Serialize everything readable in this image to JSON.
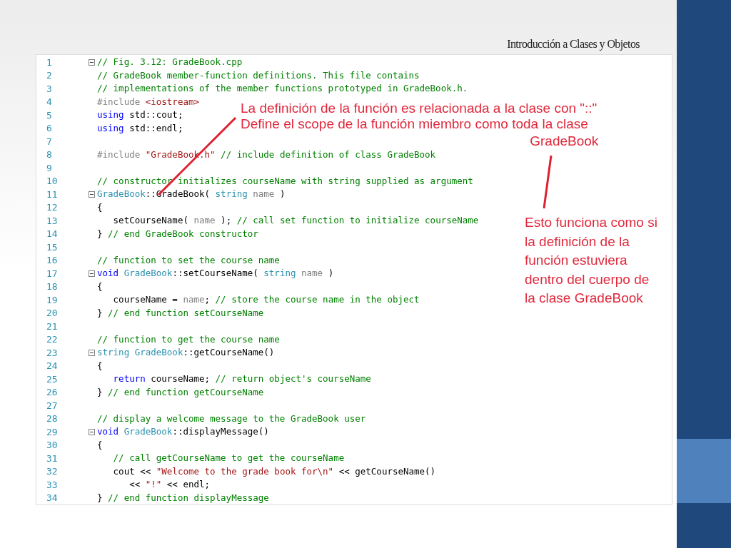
{
  "slide": {
    "title": "Introducción a Clases y Objetos"
  },
  "code": {
    "lines": [
      {
        "number": "1",
        "fold": true,
        "tokens": [
          {
            "kind": "comment",
            "text": "// Fig. 3.12: GradeBook.cpp"
          }
        ]
      },
      {
        "number": "2",
        "fold": false,
        "tokens": [
          {
            "kind": "comment",
            "text": "// GradeBook member-function definitions. This file contains"
          }
        ]
      },
      {
        "number": "3",
        "fold": false,
        "tokens": [
          {
            "kind": "comment",
            "text": "// implementations of the member functions prototyped in GradeBook.h."
          }
        ]
      },
      {
        "number": "4",
        "fold": false,
        "tokens": [
          {
            "kind": "preproc",
            "text": "#include "
          },
          {
            "kind": "string",
            "text": "<iostream>"
          }
        ]
      },
      {
        "number": "5",
        "fold": false,
        "tokens": [
          {
            "kind": "keyword",
            "text": "using"
          },
          {
            "kind": "plain",
            "text": " std::cout;"
          }
        ]
      },
      {
        "number": "6",
        "fold": false,
        "tokens": [
          {
            "kind": "keyword",
            "text": "using"
          },
          {
            "kind": "plain",
            "text": " std::endl;"
          }
        ]
      },
      {
        "number": "7",
        "fold": false
      },
      {
        "number": "8",
        "fold": false,
        "tokens": [
          {
            "kind": "preproc",
            "text": "#include "
          },
          {
            "kind": "string",
            "text": "\"GradeBook.h\""
          },
          {
            "kind": "comment",
            "text": " // include definition of class GradeBook"
          }
        ]
      },
      {
        "number": "9",
        "fold": false
      },
      {
        "number": "10",
        "fold": false,
        "tokens": [
          {
            "kind": "comment",
            "text": "// constructor initializes courseName with string supplied as argument"
          }
        ]
      },
      {
        "number": "11",
        "fold": true,
        "tokens": [
          {
            "kind": "type",
            "text": "GradeBook"
          },
          {
            "kind": "plain",
            "text": "::GradeBook( "
          },
          {
            "kind": "type",
            "text": "string"
          },
          {
            "kind": "param",
            "text": " name"
          },
          {
            "kind": "plain",
            "text": " )"
          }
        ]
      },
      {
        "number": "12",
        "fold": false,
        "tokens": [
          {
            "kind": "plain",
            "text": "{"
          }
        ]
      },
      {
        "number": "13",
        "fold": false,
        "tokens": [
          {
            "kind": "plain",
            "text": "   setCourseName( "
          },
          {
            "kind": "param",
            "text": "name"
          },
          {
            "kind": "plain",
            "text": " );"
          },
          {
            "kind": "comment",
            "text": " // call set function to initialize courseName"
          }
        ]
      },
      {
        "number": "14",
        "fold": false,
        "tokens": [
          {
            "kind": "plain",
            "text": "}"
          },
          {
            "kind": "comment",
            "text": " // end GradeBook constructor"
          }
        ]
      },
      {
        "number": "15",
        "fold": false
      },
      {
        "number": "16",
        "fold": false,
        "tokens": [
          {
            "kind": "comment",
            "text": "// function to set the course name"
          }
        ]
      },
      {
        "number": "17",
        "fold": true,
        "tokens": [
          {
            "kind": "keyword",
            "text": "void"
          },
          {
            "kind": "type",
            "text": " GradeBook"
          },
          {
            "kind": "plain",
            "text": "::setCourseName( "
          },
          {
            "kind": "type",
            "text": "string"
          },
          {
            "kind": "param",
            "text": " name"
          },
          {
            "kind": "plain",
            "text": " )"
          }
        ]
      },
      {
        "number": "18",
        "fold": false,
        "tokens": [
          {
            "kind": "plain",
            "text": "{"
          }
        ]
      },
      {
        "number": "19",
        "fold": false,
        "tokens": [
          {
            "kind": "plain",
            "text": "   courseName = "
          },
          {
            "kind": "param",
            "text": "name"
          },
          {
            "kind": "plain",
            "text": ";"
          },
          {
            "kind": "comment",
            "text": " // store the course name in the object"
          }
        ]
      },
      {
        "number": "20",
        "fold": false,
        "tokens": [
          {
            "kind": "plain",
            "text": "}"
          },
          {
            "kind": "comment",
            "text": " // end function setCourseName"
          }
        ]
      },
      {
        "number": "21",
        "fold": false
      },
      {
        "number": "22",
        "fold": false,
        "tokens": [
          {
            "kind": "comment",
            "text": "// function to get the course name"
          }
        ]
      },
      {
        "number": "23",
        "fold": true,
        "tokens": [
          {
            "kind": "type",
            "text": "string GradeBook"
          },
          {
            "kind": "plain",
            "text": "::getCourseName()"
          }
        ]
      },
      {
        "number": "24",
        "fold": false,
        "tokens": [
          {
            "kind": "plain",
            "text": "{"
          }
        ]
      },
      {
        "number": "25",
        "fold": false,
        "tokens": [
          {
            "kind": "keyword",
            "text": "   return"
          },
          {
            "kind": "plain",
            "text": " courseName;"
          },
          {
            "kind": "comment",
            "text": " // return object's courseName"
          }
        ]
      },
      {
        "number": "26",
        "fold": false,
        "tokens": [
          {
            "kind": "plain",
            "text": "}"
          },
          {
            "kind": "comment",
            "text": " // end function getCourseName"
          }
        ]
      },
      {
        "number": "27",
        "fold": false
      },
      {
        "number": "28",
        "fold": false,
        "tokens": [
          {
            "kind": "comment",
            "text": "// display a welcome message to the GradeBook user"
          }
        ]
      },
      {
        "number": "29",
        "fold": true,
        "tokens": [
          {
            "kind": "keyword",
            "text": "void"
          },
          {
            "kind": "type",
            "text": " GradeBook"
          },
          {
            "kind": "plain",
            "text": "::displayMessage()"
          }
        ]
      },
      {
        "number": "30",
        "fold": false,
        "tokens": [
          {
            "kind": "plain",
            "text": "{"
          }
        ]
      },
      {
        "number": "31",
        "fold": false,
        "tokens": [
          {
            "kind": "comment",
            "text": "   // call getCourseName to get the courseName"
          }
        ]
      },
      {
        "number": "32",
        "fold": false,
        "tokens": [
          {
            "kind": "plain",
            "text": "   cout << "
          },
          {
            "kind": "string",
            "text": "\"Welcome to the grade book for\\n\""
          },
          {
            "kind": "plain",
            "text": " << getCourseName()"
          }
        ]
      },
      {
        "number": "33",
        "fold": false,
        "tokens": [
          {
            "kind": "plain",
            "text": "      << "
          },
          {
            "kind": "string",
            "text": "\"!\""
          },
          {
            "kind": "plain",
            "text": " << endl;"
          }
        ]
      },
      {
        "number": "34",
        "fold": false,
        "tokens": [
          {
            "kind": "plain",
            "text": "}"
          },
          {
            "kind": "comment",
            "text": " // end function displayMessage"
          }
        ]
      }
    ]
  },
  "annotations": [
    {
      "lines": [
        "La definición de la función es relacionada a la clase con \"::\"",
        "Define el scope de la función miembro como toda la clase"
      ],
      "tail": "GradeBook"
    },
    {
      "lines": [
        "Esto funciona como si",
        "la definición de la",
        "función estuviera",
        "dentro del cuerpo de",
        "la clase GradeBook"
      ]
    }
  ]
}
